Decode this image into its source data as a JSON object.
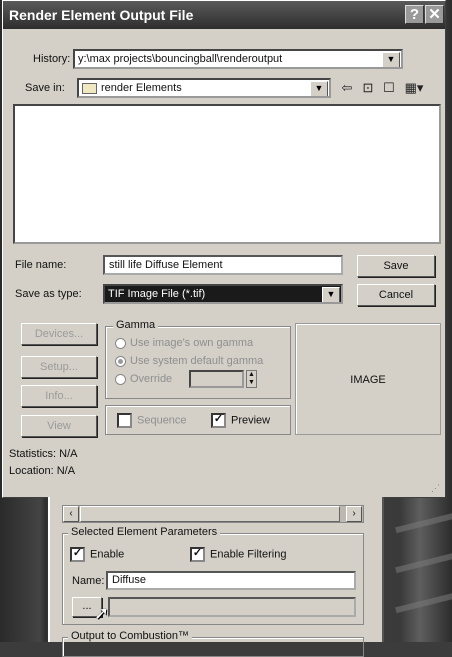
{
  "dialog": {
    "title": "Render Element Output File",
    "help_glyph": "?",
    "close_glyph": "✕",
    "history": {
      "label": "History:",
      "value": "y:\\max projects\\bouncingball\\renderoutput"
    },
    "save_in": {
      "label": "Save in:",
      "value": "render Elements"
    },
    "file_name": {
      "label": "File name:",
      "value": "still life Diffuse Element"
    },
    "save_as_type": {
      "label": "Save as type:",
      "value": "TIF Image File (*.tif)"
    },
    "buttons": {
      "save": "Save",
      "cancel": "Cancel",
      "devices": "Devices...",
      "setup": "Setup...",
      "info": "Info...",
      "view": "View"
    },
    "gamma": {
      "title": "Gamma",
      "own": "Use image's own gamma",
      "system": "Use system default gamma",
      "override": "Override"
    },
    "sequence_label": "Sequence",
    "preview_label": "Preview",
    "preview_checked": true,
    "image_label": "IMAGE",
    "statistics": "Statistics:  N/A",
    "location": "Location:  N/A"
  },
  "panel": {
    "section_title": "Selected Element Parameters",
    "enable_label": "Enable",
    "enable_filtering_label": "Enable Filtering",
    "name_label": "Name:",
    "name_value": "Diffuse",
    "browse_label": "...",
    "output_title": "Output to Combustion™"
  },
  "colors": {
    "title_bar": "#2e2e2e",
    "dialog_bg": "#d4d0c8"
  }
}
